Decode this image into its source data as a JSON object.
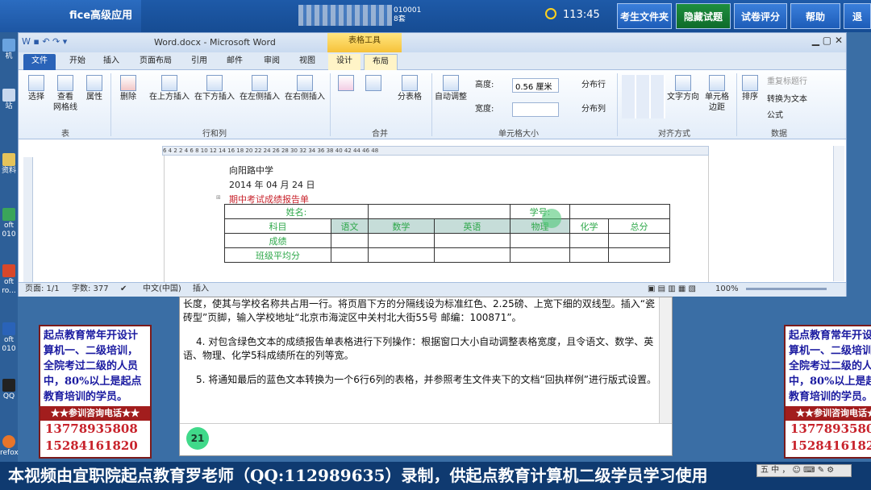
{
  "exam": {
    "title": "fice高级应用",
    "id": "010001",
    "seat": "8套",
    "time": "113:45",
    "buttons": [
      "考生文件夹",
      "隐藏试题",
      "试卷评分",
      "帮助",
      "退"
    ]
  },
  "desktop": {
    "icons": [
      "机",
      "站",
      "资料",
      "oft\n010",
      "oft\nro...",
      "oft\n010",
      "QQ",
      "refox"
    ]
  },
  "word": {
    "filename": "Word.docx - Microsoft Word",
    "context_tab": "表格工具",
    "tabs": [
      "文件",
      "开始",
      "插入",
      "页面布局",
      "引用",
      "邮件",
      "审阅",
      "视图",
      "设计",
      "布局"
    ],
    "ribbon": {
      "buttons": [
        "选择",
        "查看\n网格线",
        "属性",
        "删除",
        "在上方插入",
        "在下方插入",
        "在左侧插入",
        "在右侧插入",
        "分表格",
        "自动调整",
        "分布行",
        "分布列",
        "文字方向",
        "单元格\n边距",
        "排序",
        "重复标题行",
        "转换为文本",
        "公式"
      ],
      "height_label": "高度:",
      "height_value": "0.56 厘米",
      "width_label": "宽度:",
      "groups": [
        "表",
        "行和列",
        "合并",
        "单元格大小",
        "对齐方式",
        "数据"
      ]
    },
    "ruler": "6 4 2 2 4 6 8 10 12 14 16 18 20 22 24 26 28 30 32 34 36 38 40 42 44 46 48",
    "doc": {
      "line1": "向阳路中学",
      "line2": "2014 年 04 月 24 日",
      "line3": "期中考试成绩报告单",
      "table": {
        "name_label": "姓名:",
        "id_label": "学号:",
        "subject_label": "科目",
        "subjects": [
          "语文",
          "数学",
          "英语",
          "物理",
          "化学",
          "总分"
        ],
        "score_label": "成绩",
        "avg_label": "班级平均分"
      }
    },
    "status": {
      "page": "页面: 1/1",
      "words": "字数: 377",
      "lang": "中文(中国)",
      "mode": "插入",
      "zoom": "100%"
    }
  },
  "questions": {
    "q3_tail": "长度，使其与学校名称共占用一行。将页眉下方的分隔线设为标准红色、2.25磅、上宽下细的双线型。插入“瓷砖型”页脚，输入学校地址“北京市海淀区中关村北大街55号 邮编：100871”。",
    "q4": "4. 对包含绿色文本的成绩报告单表格进行下列操作：根据窗口大小自动调整表格宽度，且令语文、数学、英语、物理、化学5科成绩所在的列等宽。",
    "q5": "5. 将通知最后的蓝色文本转换为一个6行6列的表格，并参照考生文件夹下的文档“回执样例”进行版式设置。",
    "number": "21"
  },
  "ad": {
    "text": "起点教育常年开设计算机一、二级培训，全院考过二级的人员中，80%以上是起点教育培训的学员。",
    "bar": "★★参训咨询电话★★",
    "phone1": "13778935808",
    "phone2": "15284161820"
  },
  "caption": "本视频由宜职院起点教育罗老师（QQ:112989635）录制，供起点教育计算机二级学员学习使用",
  "ime": "五 中 ， ☺ ⌨ ✎ ⚙"
}
